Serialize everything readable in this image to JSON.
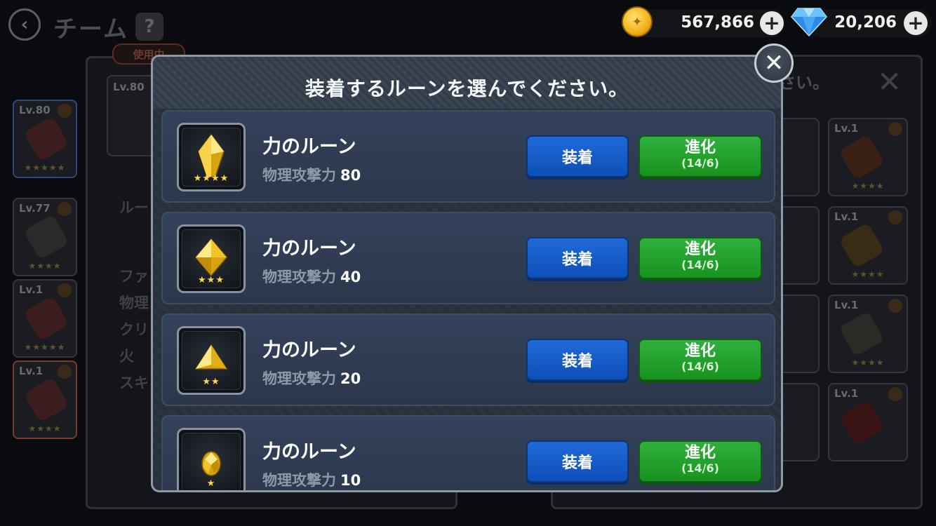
{
  "background": {
    "title": "チーム",
    "back_icon": "‹",
    "help_icon": "?",
    "in_use_badge": "使用中",
    "main_card_level": "Lv.80",
    "left_cards": [
      {
        "level": "Lv.80",
        "stars": "★★★★★"
      },
      {
        "level": "Lv.77",
        "stars": "★★★★"
      },
      {
        "level": "Lv.1",
        "stars": "★★★★★"
      },
      {
        "level": "Lv.1",
        "stars": "★★★★"
      }
    ],
    "left_texts": [
      "ルー",
      "ファ",
      "物理",
      "クリ",
      "火",
      "スキ"
    ],
    "right_header_text": "さい。",
    "right_close_icon": "✕",
    "right_cards": [
      {
        "level": "Lv.1",
        "stars": "★★★★"
      },
      {
        "level": "Lv.1",
        "stars": "★★★★"
      },
      {
        "level": "Lv.1",
        "stars": "★★★★"
      },
      {
        "level": "Lv.1",
        "stars": "★★★★"
      }
    ]
  },
  "currency": {
    "gold": "567,866",
    "gems": "20,206",
    "plus_label": "+"
  },
  "modal": {
    "title": "装着するルーンを選んでください。",
    "close_icon": "✕",
    "runes": [
      {
        "name": "力のルーン",
        "stat_label": "物理攻撃力",
        "stat_value": "80",
        "stars": "★★★★",
        "shape": "crystal-large",
        "equip_label": "装着",
        "evolve_label": "進化",
        "evolve_progress": "(14/6)"
      },
      {
        "name": "力のルーン",
        "stat_label": "物理攻撃力",
        "stat_value": "40",
        "stars": "★★★",
        "shape": "octahedron",
        "equip_label": "装着",
        "evolve_label": "進化",
        "evolve_progress": "(14/6)"
      },
      {
        "name": "力のルーン",
        "stat_label": "物理攻撃力",
        "stat_value": "20",
        "stars": "★★",
        "shape": "pyramid",
        "equip_label": "装着",
        "evolve_label": "進化",
        "evolve_progress": "(14/6)"
      },
      {
        "name": "力のルーン",
        "stat_label": "物理攻撃力",
        "stat_value": "10",
        "stars": "★",
        "shape": "nugget",
        "equip_label": "装着",
        "evolve_label": "進化",
        "evolve_progress": "(14/6)"
      }
    ]
  },
  "colors": {
    "equip_button": "#1560cc",
    "evolve_button": "#23a22e",
    "rune_gold": "#f2c32a",
    "star": "#ffd84a"
  }
}
